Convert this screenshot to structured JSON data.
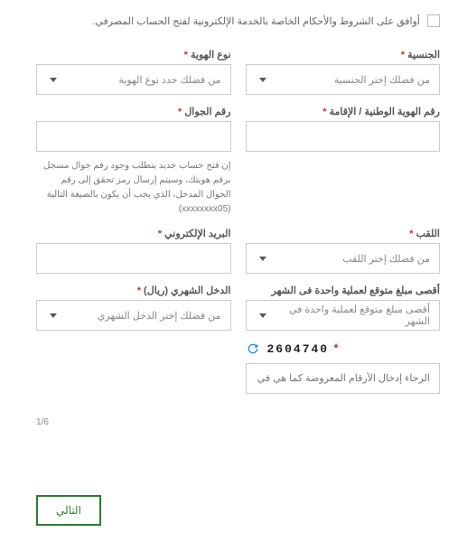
{
  "consent": {
    "label": "أوافق على الشروط والأحكام الخاصة بالخدمة الإلكترونية لفتح الحساب المصرفي."
  },
  "fields": {
    "nationality": {
      "label": "الجنسية",
      "placeholder": "من فضلك إختر الجنسية"
    },
    "idType": {
      "label": "نوع الهوية",
      "placeholder": "من فضلك حدد نوع الهوية"
    },
    "nationalId": {
      "label": "رقم الهوية الوطنية / الإقامة"
    },
    "mobile": {
      "label": "رقم الجوال",
      "helper": "إن فتح حساب جديد يتطلب وجود رقم جوال مسجل برقم هويتك، وسيتم إرسال رمز تحقق إلى رقم الجوال المدخل، الذي يجب أن يكون بالصيغة التالية (xxxxxxxx05)"
    },
    "title": {
      "label": "اللقب",
      "placeholder": "من فضلك إختر اللقب"
    },
    "email": {
      "label": "البريد الإلكتروني"
    },
    "maxAmount": {
      "label": "أقصى مبلغ متوقع لعملية واحدة فى الشهر",
      "placeholder": "أقصى مبلغ متوقع لعملية واحدة في الشهر"
    },
    "income": {
      "label": "الدخل الشهري (ريال)",
      "placeholder": "من فضلك إختر الدخل الشهري"
    },
    "captcha": {
      "code": "2604740",
      "placeholder": "الرجاء إدخال الأرقام المعروضة كما هي في الصورة"
    }
  },
  "pager": "1/6",
  "nextButton": "التالي",
  "req": "*"
}
